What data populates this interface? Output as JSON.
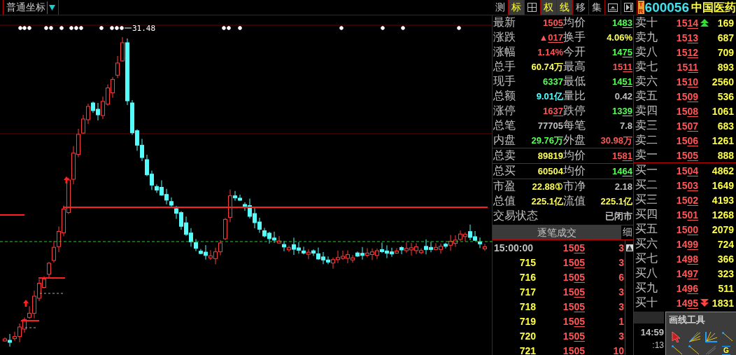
{
  "toolbar": {
    "coord_label": "普通坐标",
    "buttons": [
      {
        "kind": "text",
        "label": "测",
        "selected": false
      },
      {
        "kind": "text",
        "label": "标",
        "selected": true
      },
      {
        "kind": "grid",
        "selected": false
      },
      {
        "kind": "text",
        "label": "权",
        "selected": true
      },
      {
        "kind": "text",
        "label": "线",
        "selected": true
      },
      {
        "kind": "text",
        "label": "移",
        "selected": false
      },
      {
        "kind": "text",
        "label": "集",
        "selected": false
      },
      {
        "kind": "window",
        "selected": false
      },
      {
        "kind": "play",
        "selected": false
      }
    ],
    "badge": "TR",
    "code": "600056",
    "name": "中国医药"
  },
  "chart": {
    "peak_label": "31.48"
  },
  "quote": {
    "sections": [
      {
        "rows": [
          {
            "cells": [
              {
                "label": "最新",
                "text": "15",
                "tail": "05",
                "color": "#ff5555"
              },
              {
                "label": "均价",
                "text": "14",
                "tail": "83",
                "color": "#55ff55"
              }
            ]
          },
          {
            "cells": [
              {
                "label": "涨跌",
                "text": "▲",
                "tail": "017",
                "color": "#ff5555"
              },
              {
                "label": "换手",
                "text": "4.06%",
                "color": "#ffff55"
              }
            ]
          },
          {
            "cells": [
              {
                "label": "涨幅",
                "text": "1.14%",
                "color": "#ff5555"
              },
              {
                "label": "今开",
                "text": "14",
                "tail": "75",
                "color": "#55ff55"
              }
            ]
          },
          {
            "cells": [
              {
                "label": "总手",
                "text": "60.74万",
                "color": "#ffff55"
              },
              {
                "label": "最高",
                "text": "15",
                "tail": "11",
                "color": "#ff5555"
              }
            ]
          },
          {
            "cells": [
              {
                "label": "现手",
                "text": "6337",
                "color": "#55ff55"
              },
              {
                "label": "最低",
                "text": "14",
                "tail": "51",
                "color": "#55ff55"
              }
            ]
          },
          {
            "cells": [
              {
                "label": "总额",
                "text": "9.01亿",
                "color": "#55ffff"
              },
              {
                "label": "量比",
                "text": "0.42",
                "color": "#c0c0c0"
              }
            ]
          },
          {
            "cells": [
              {
                "label": "涨停",
                "text": "16",
                "tail": "37",
                "color": "#ff5555"
              },
              {
                "label": "跌停",
                "text": "13",
                "tail": "39",
                "color": "#55ff55"
              }
            ]
          },
          {
            "cells": [
              {
                "label": "总笔",
                "text": "77705",
                "color": "#c0c0c0"
              },
              {
                "label": "每笔",
                "text": "7.8",
                "color": "#c0c0c0"
              }
            ]
          },
          {
            "cells": [
              {
                "label": "内盘",
                "text": "29.76万",
                "color": "#55ff55"
              },
              {
                "label": "外盘",
                "text": "30.98万",
                "color": "#ff5555"
              }
            ]
          }
        ]
      },
      {
        "rows": [
          {
            "cells": [
              {
                "label": "总卖",
                "text": "89819",
                "color": "#ffff55"
              },
              {
                "label": "均价",
                "text": "15",
                "tail": "81",
                "color": "#ff5555"
              }
            ]
          }
        ]
      },
      {
        "rows": [
          {
            "cells": [
              {
                "label": "总买",
                "text": "60504",
                "color": "#ffff55"
              },
              {
                "label": "均价",
                "text": "14",
                "tail": "64",
                "color": "#55ff55"
              }
            ]
          }
        ]
      },
      {
        "rows": [
          {
            "cells": [
              {
                "label": "市盈",
                "text": "22.88①",
                "color": "#ffff55"
              },
              {
                "label": "市净",
                "text": "2.18",
                "color": "#c0c0c0"
              }
            ]
          },
          {
            "cells": [
              {
                "label": "总值",
                "text": "225.1亿",
                "color": "#ffff55"
              },
              {
                "label": "流值",
                "text": "225.1亿",
                "color": "#ffff55"
              }
            ]
          },
          {
            "cells": [
              {
                "label": "交易状态",
                "text": "已闭市",
                "color": "#c0c0c0"
              }
            ]
          }
        ]
      }
    ]
  },
  "book": {
    "asks": [
      {
        "label": "卖十",
        "text": "15",
        "tail": "14",
        "volume": "169",
        "marker": true
      },
      {
        "label": "卖九",
        "text": "15",
        "tail": "13",
        "volume": "687",
        "marker": false
      },
      {
        "label": "卖八",
        "text": "15",
        "tail": "12",
        "volume": "709",
        "marker": false
      },
      {
        "label": "卖七",
        "text": "15",
        "tail": "11",
        "volume": "893",
        "marker": false
      },
      {
        "label": "卖六",
        "text": "15",
        "tail": "10",
        "volume": "2560",
        "marker": false
      },
      {
        "label": "卖五",
        "text": "15",
        "tail": "09",
        "volume": "536",
        "marker": false
      },
      {
        "label": "卖四",
        "text": "15",
        "tail": "08",
        "volume": "1061",
        "marker": false
      },
      {
        "label": "卖三",
        "text": "15",
        "tail": "07",
        "volume": "683",
        "marker": false
      },
      {
        "label": "卖二",
        "text": "15",
        "tail": "06",
        "volume": "1261",
        "marker": false
      },
      {
        "label": "卖一",
        "text": "15",
        "tail": "05",
        "volume": "888",
        "marker": false
      }
    ],
    "bids": [
      {
        "label": "买一",
        "text": "15",
        "tail": "04",
        "volume": "4862",
        "marker": false
      },
      {
        "label": "买二",
        "text": "15",
        "tail": "03",
        "volume": "1649",
        "marker": false
      },
      {
        "label": "买三",
        "text": "15",
        "tail": "02",
        "volume": "4193",
        "marker": false
      },
      {
        "label": "买四",
        "text": "15",
        "tail": "01",
        "volume": "1268",
        "marker": false
      },
      {
        "label": "买五",
        "text": "15",
        "tail": "00",
        "volume": "2079",
        "marker": false
      },
      {
        "label": "买六",
        "text": "14",
        "tail": "99",
        "volume": "724",
        "marker": false
      },
      {
        "label": "买七",
        "text": "14",
        "tail": "98",
        "volume": "366",
        "marker": false
      },
      {
        "label": "买八",
        "text": "14",
        "tail": "97",
        "volume": "323",
        "marker": false
      },
      {
        "label": "买九",
        "text": "14",
        "tail": "96",
        "volume": "511",
        "marker": false
      },
      {
        "label": "买十",
        "text": "14",
        "tail": "95",
        "volume": "1831",
        "marker": true
      }
    ]
  },
  "ticks": {
    "header": "逐笔成交",
    "detail": "细",
    "rows": [
      {
        "kind": "time",
        "time": "15:00:00",
        "text": "15",
        "tail": "05",
        "volume": "3"
      },
      {
        "kind": "seq",
        "time": "715",
        "text": "15",
        "tail": "05",
        "volume": "3"
      },
      {
        "kind": "seq",
        "time": "716",
        "text": "15",
        "tail": "05",
        "volume": "6"
      },
      {
        "kind": "seq",
        "time": "717",
        "text": "15",
        "tail": "05",
        "volume": "3"
      },
      {
        "kind": "seq",
        "time": "718",
        "text": "15",
        "tail": "05",
        "volume": "3"
      },
      {
        "kind": "seq",
        "time": "719",
        "text": "15",
        "tail": "05",
        "volume": "1"
      },
      {
        "kind": "seq",
        "time": "720",
        "text": "15",
        "tail": "05",
        "volume": "3"
      },
      {
        "kind": "seq",
        "time": "721",
        "text": "15",
        "tail": "05",
        "volume": "10"
      }
    ]
  },
  "clock": {
    "time": "14:59",
    "seconds": ":13"
  },
  "draw_tools": {
    "title": "画线工具",
    "tools": [
      {
        "kind": "cursor"
      },
      {
        "kind": "fan"
      },
      {
        "kind": "fan-box"
      },
      {
        "kind": "line"
      },
      {
        "kind": "line"
      },
      {
        "kind": "line"
      },
      {
        "kind": "dim-line"
      },
      {
        "kind": "label",
        "text": "G"
      }
    ]
  }
}
